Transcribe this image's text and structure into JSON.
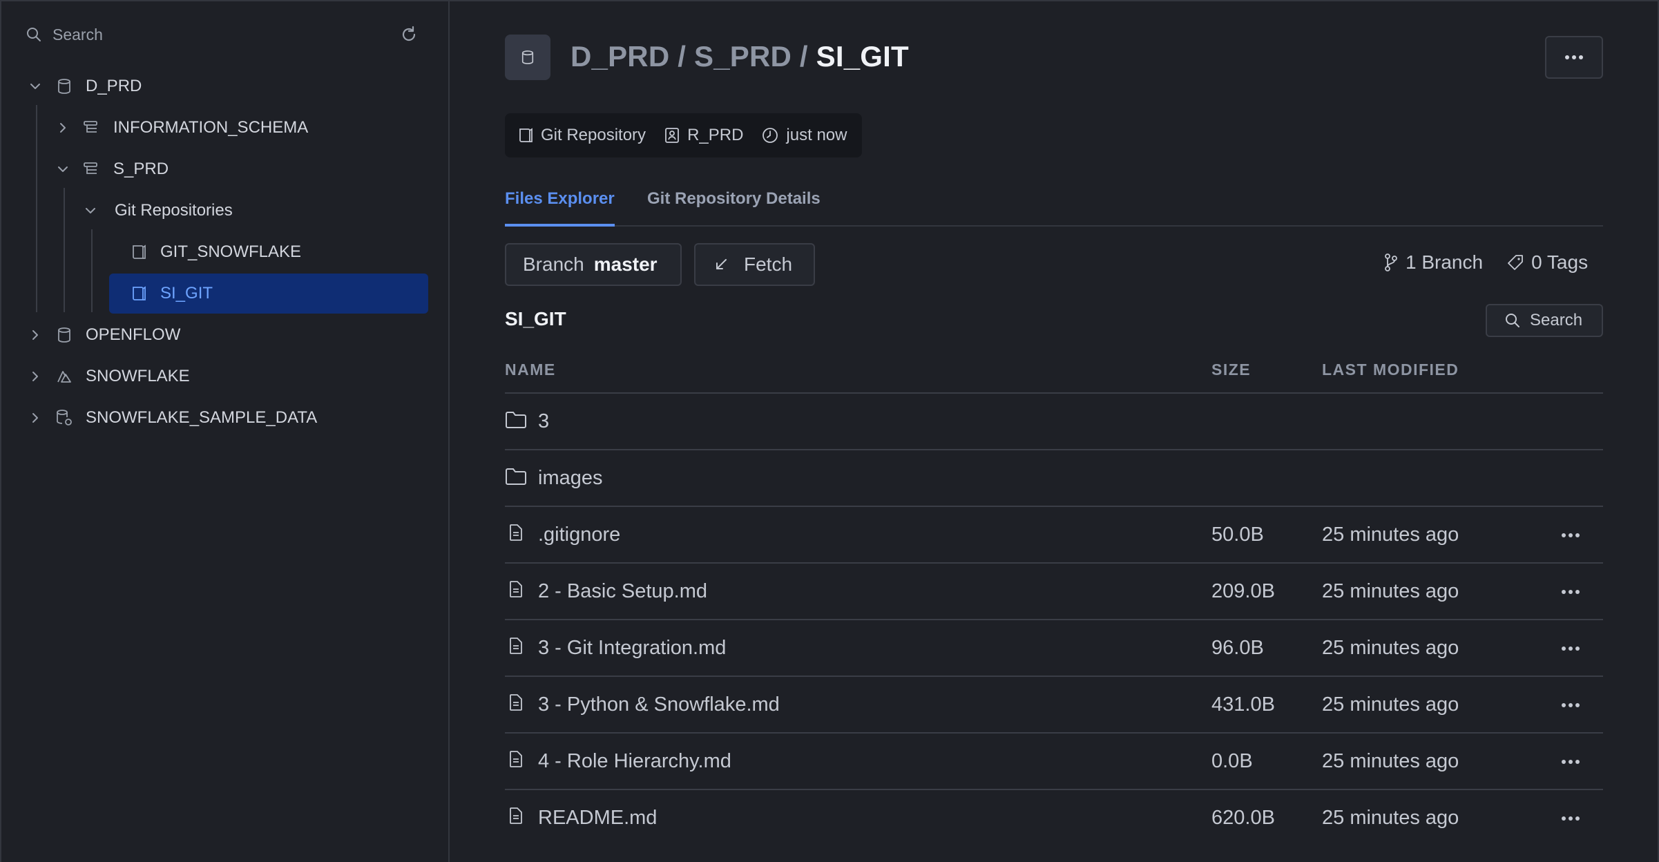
{
  "sidebar": {
    "search_placeholder": "Search",
    "tree": [
      {
        "label": "D_PRD",
        "icon": "database-icon",
        "expanded": true
      },
      {
        "label": "INFORMATION_SCHEMA",
        "icon": "schema-icon",
        "expanded": false
      },
      {
        "label": "S_PRD",
        "icon": "schema-icon",
        "expanded": true
      },
      {
        "label": "Git Repositories",
        "icon": "",
        "expanded": true
      },
      {
        "label": "GIT_SNOWFLAKE",
        "icon": "git-repo-icon"
      },
      {
        "label": "SI_GIT",
        "icon": "git-repo-icon",
        "selected": true
      },
      {
        "label": "OPENFLOW",
        "icon": "database-icon",
        "expanded": false
      },
      {
        "label": "SNOWFLAKE",
        "icon": "snowflake-db-icon",
        "expanded": false
      },
      {
        "label": "SNOWFLAKE_SAMPLE_DATA",
        "icon": "shared-database-icon",
        "expanded": false
      }
    ]
  },
  "header": {
    "crumb_db": "D_PRD",
    "crumb_sep": " / ",
    "crumb_schema": "S_PRD",
    "crumb_repo": "SI_GIT",
    "meta": {
      "type": "Git Repository",
      "role": "R_PRD",
      "time": "just now"
    }
  },
  "tabs": [
    {
      "label": "Files Explorer",
      "active": true
    },
    {
      "label": "Git Repository Details",
      "active": false
    }
  ],
  "toolbar": {
    "branch_label": "Branch",
    "branch_value": "master",
    "fetch_label": "Fetch",
    "branches_count": "1 Branch",
    "tags_count": "0 Tags"
  },
  "files": {
    "title": "SI_GIT",
    "search_label": "Search",
    "columns": {
      "name": "NAME",
      "size": "SIZE",
      "modified": "LAST MODIFIED"
    },
    "rows": [
      {
        "type": "folder",
        "name": "3",
        "size": "",
        "modified": ""
      },
      {
        "type": "folder",
        "name": "images",
        "size": "",
        "modified": ""
      },
      {
        "type": "file",
        "name": ".gitignore",
        "size": "50.0B",
        "modified": "25 minutes ago"
      },
      {
        "type": "file",
        "name": "2 - Basic Setup.md",
        "size": "209.0B",
        "modified": "25 minutes ago"
      },
      {
        "type": "file",
        "name": "3 - Git Integration.md",
        "size": "96.0B",
        "modified": "25 minutes ago"
      },
      {
        "type": "file",
        "name": "3 - Python & Snowflake.md",
        "size": "431.0B",
        "modified": "25 minutes ago"
      },
      {
        "type": "file",
        "name": "4 - Role Hierarchy.md",
        "size": "0.0B",
        "modified": "25 minutes ago"
      },
      {
        "type": "file",
        "name": "README.md",
        "size": "620.0B",
        "modified": "25 minutes ago"
      }
    ]
  },
  "colors": {
    "background": "#1e2026",
    "accent": "#5b8ff0",
    "selected_bg": "#0f2d74"
  }
}
